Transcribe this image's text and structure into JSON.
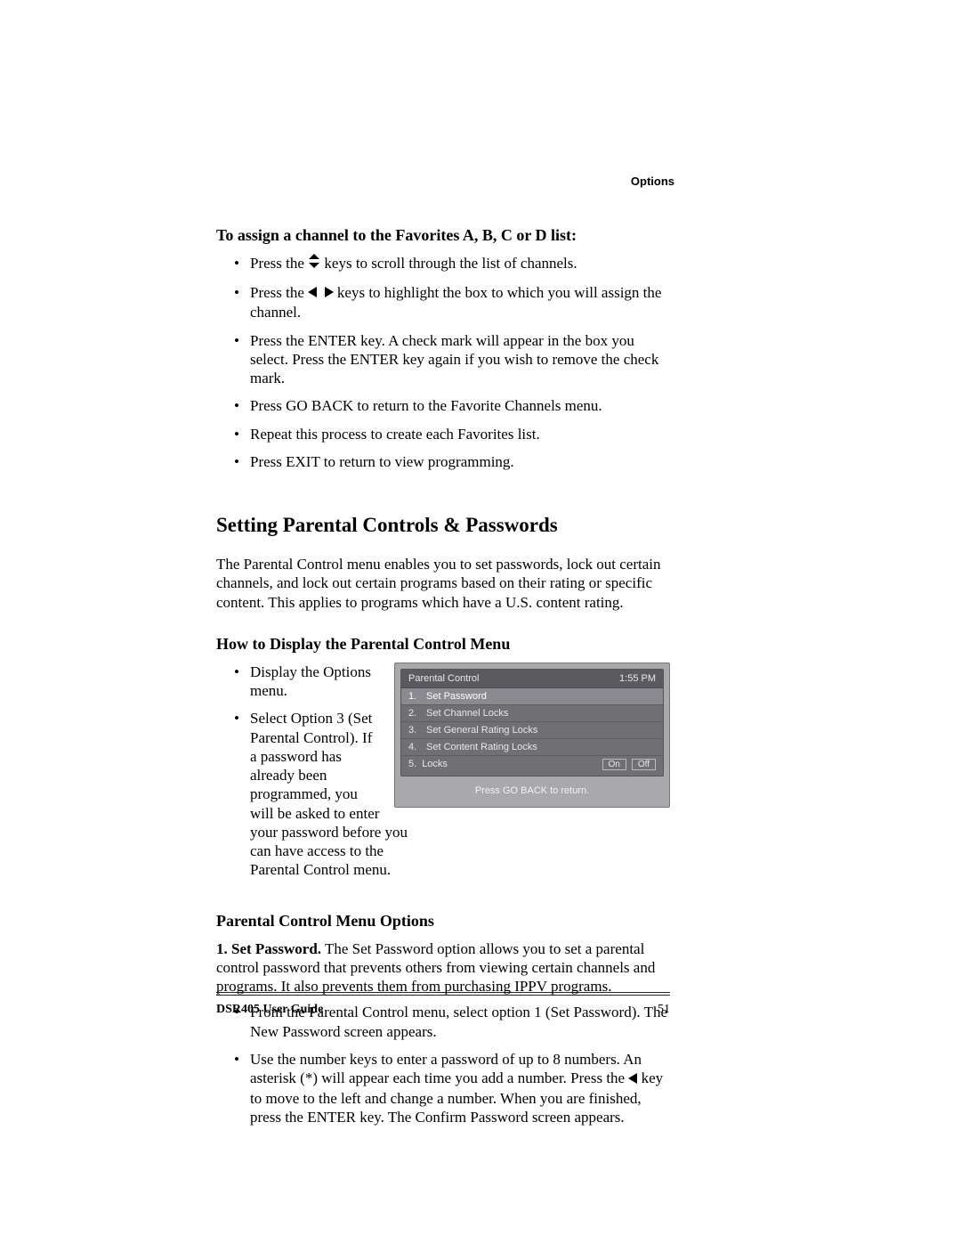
{
  "header": {
    "section": "Options"
  },
  "s1": {
    "heading": "To assign a channel to the Favorites A, B, C or D list:",
    "b1a": "Press the ",
    "b1b": " keys to scroll through the list of channels.",
    "b2a": "Press the ",
    "b2b": " keys to highlight the box to which you will assign the channel.",
    "b3": "Press the ENTER key. A check mark will appear in the box you select. Press the ENTER key again if you wish to remove the check mark.",
    "b4": "Press GO BACK to return to the Favorite Channels menu.",
    "b5": "Repeat this process to create each Favorites list.",
    "b6": "Press EXIT to return to view programming."
  },
  "s2": {
    "heading": "Setting Parental Controls & Passwords",
    "para": " The Parental Control menu enables you to set passwords, lock out certain channels, and lock out certain programs based on their rating or specific content. This applies to programs which have a U.S. content rating."
  },
  "s3": {
    "heading": "How to Display the Parental Control Menu",
    "b1": "Display the Options menu.",
    "b2": "Select Option 3 (Set Parental Control). If a password has already been programmed, you will be asked to enter your password before you can have access to the Parental Control menu."
  },
  "pc": {
    "title": "Parental Control",
    "time": "1:55 PM",
    "r1": "Set Password",
    "r2": "Set Channel Locks",
    "r3": "Set General Rating Locks",
    "r4": "Set Content Rating Locks",
    "r5": "Locks",
    "on": "On",
    "off": "Off",
    "foot": "Press GO BACK to return."
  },
  "s4": {
    "heading": "Parental Control Menu Options",
    "p1strong": "1. Set Password.",
    "p1rest": " The Set Password option allows you to set a parental control password that prevents others from viewing certain channels and programs. It also prevents them from purchasing IPPV programs.",
    "b1": "From the Parental Control menu, select option 1 (Set Password). The New Password screen appears.",
    "b2a": "Use the number keys to enter a password of up to 8 numbers. An asterisk (*) will appear each time you add a number. Press the ",
    "b2b": " key to move to the left and change a number. When you are finished, press the ENTER key. The Confirm Password screen appears."
  },
  "footer": {
    "guide": "DSR405 User Guide",
    "page": "51"
  }
}
